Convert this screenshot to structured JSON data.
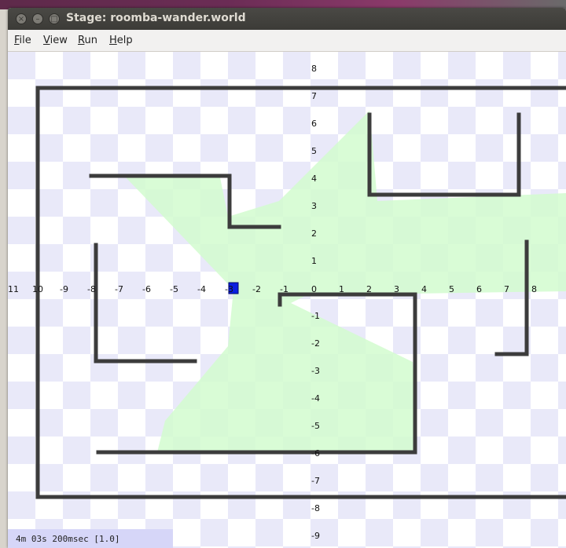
{
  "window": {
    "title": "Stage: roomba-wander.world"
  },
  "title_buttons": {
    "close": "×",
    "minimize": "–",
    "maximize": "□"
  },
  "menu": {
    "file": "File",
    "view": "View",
    "run": "Run",
    "help": "Help"
  },
  "axis_x_labels": [
    "-11",
    "10",
    "-9",
    "-8",
    "-7",
    "-6",
    "-5",
    "-4",
    "-3",
    "-2",
    "-1",
    "0",
    "1",
    "2",
    "3",
    "4",
    "5",
    "6",
    "7",
    "8"
  ],
  "axis_y_labels": [
    "8",
    "7",
    "6",
    "5",
    "4",
    "3",
    "2",
    "1",
    "-1",
    "-2",
    "-3",
    "-4",
    "-5",
    "-6",
    "-7",
    "-8",
    "-9"
  ],
  "status": {
    "text": "4m 03s 200msec [1.0]"
  },
  "colors": {
    "wall": "#3c3c3c",
    "laser": "#d2fbcf",
    "robot": "#0a1fe0",
    "checker": "#e9e9f9"
  }
}
